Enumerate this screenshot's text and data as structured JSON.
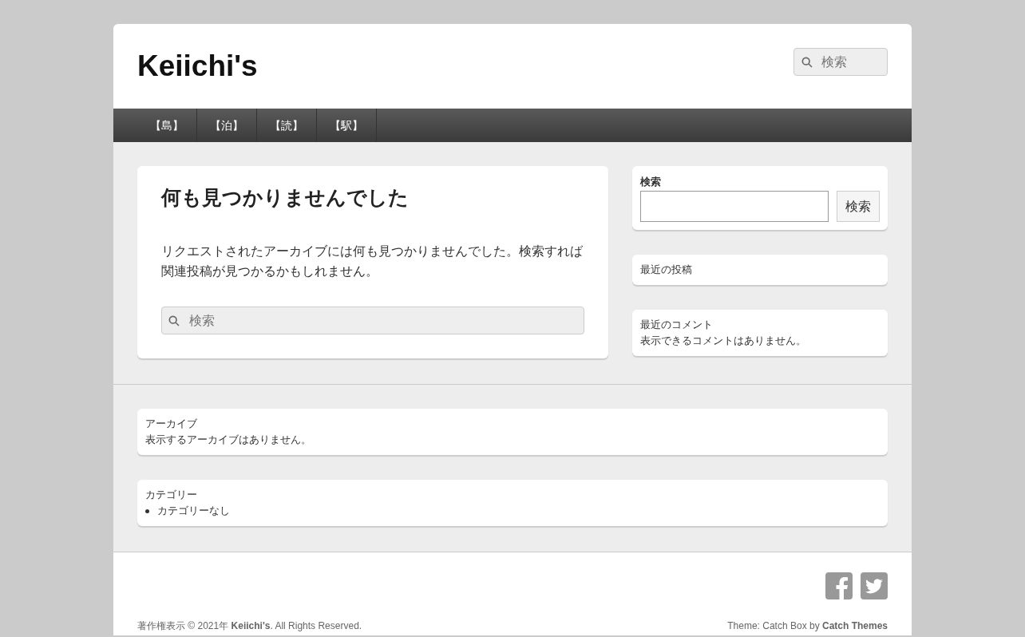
{
  "header": {
    "site_title": "Keiichi's",
    "search": {
      "placeholder": "検索"
    }
  },
  "nav": {
    "items": [
      {
        "label": "【島】"
      },
      {
        "label": "【泊】"
      },
      {
        "label": "【読】"
      },
      {
        "label": "【駅】"
      }
    ]
  },
  "main": {
    "title": "何も見つかりませんでした",
    "message": "リクエストされたアーカイブには何も見つかりませんでした。検索すれば関連投稿が見つかるかもしれません。",
    "search": {
      "placeholder": "検索"
    }
  },
  "sidebar": {
    "search_widget": {
      "title": "検索",
      "button": "検索"
    },
    "widgets": [
      {
        "title": "最近の投稿"
      },
      {
        "title": "最近のコメント",
        "text": "表示できるコメントはありません。"
      }
    ]
  },
  "footer_widgets": [
    {
      "title": "アーカイブ",
      "text": "表示するアーカイブはありません。"
    },
    {
      "title": "カテゴリー",
      "list": [
        "カテゴリーなし"
      ]
    }
  ],
  "footer": {
    "copyright": "著作権表示 © 2021年 **Keiichi's**. All Rights Reserved.",
    "credit": "Theme: Catch Box by **Catch Themes**"
  }
}
